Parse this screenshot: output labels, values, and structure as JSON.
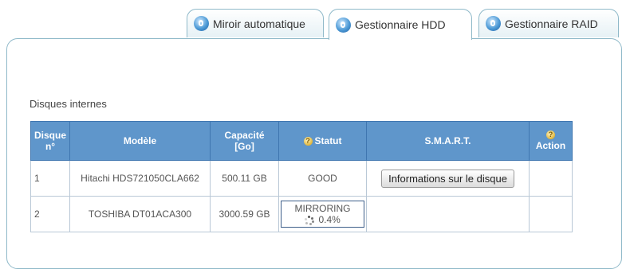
{
  "tabs": [
    {
      "label": "Miroir automatique",
      "active": false
    },
    {
      "label": "Gestionnaire HDD",
      "active": true
    },
    {
      "label": "Gestionnaire RAID",
      "active": false
    }
  ],
  "section_title": "Disques internes",
  "table": {
    "headers": {
      "disk_no": "Disque n°",
      "model": "Modèle",
      "capacity": "Capacité [Go]",
      "status": "Statut",
      "smart": "S.M.A.R.T.",
      "action": "Action"
    },
    "rows": [
      {
        "disk_no": "1",
        "model": "Hitachi HDS721050CLA662",
        "capacity": "500.11 GB",
        "status": "GOOD",
        "status_progress": "",
        "smart_button": "Informations sur le disque",
        "action": ""
      },
      {
        "disk_no": "2",
        "model": "TOSHIBA DT01ACA300",
        "capacity": "3000.59 GB",
        "status": "MIRRORING",
        "status_progress": "0.4%",
        "smart_button": "",
        "action": ""
      }
    ]
  },
  "colors": {
    "header_bg": "#5f96cb",
    "tab_border": "#8fb9c9"
  },
  "icons": {
    "tab_icon": "disk-icon",
    "help_icon": "help-icon",
    "progress_icon": "spinner-icon"
  }
}
